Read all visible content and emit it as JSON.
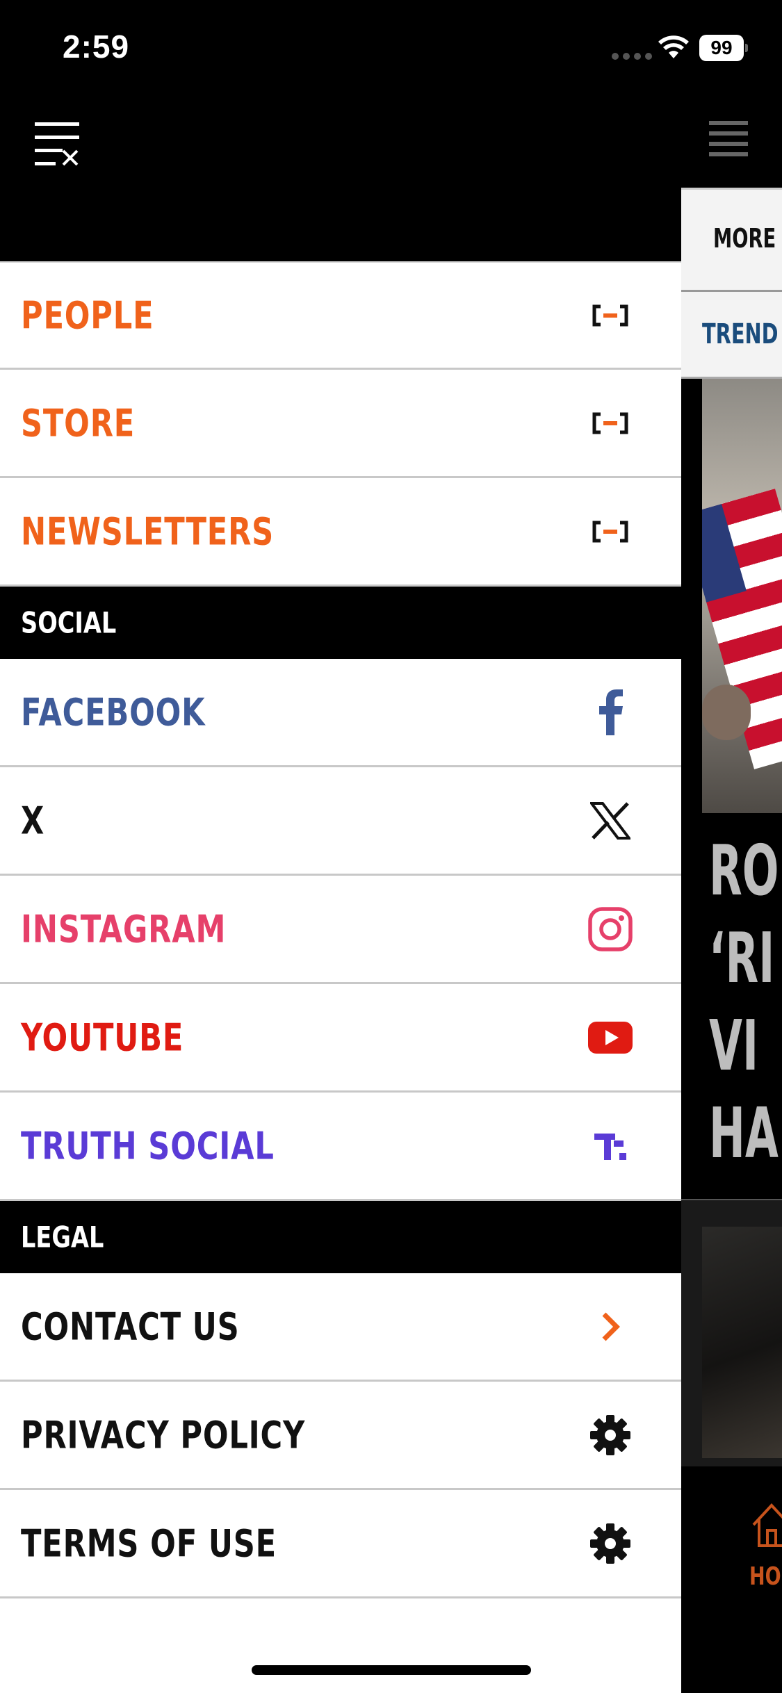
{
  "status_bar": {
    "time": "2:59",
    "battery": "99"
  },
  "background_app": {
    "more_label": "MORE",
    "trending_label": "TREND",
    "headline_lines": [
      "RO",
      "‘RI",
      "VI",
      "HA"
    ],
    "home_label": "HO"
  },
  "drawer": {
    "links": [
      {
        "label": "PEOPLE",
        "color": "#F0621B",
        "icon": "external-link-icon"
      },
      {
        "label": "STORE",
        "color": "#F0621B",
        "icon": "external-link-icon"
      },
      {
        "label": "NEWSLETTERS",
        "color": "#F0621B",
        "icon": "external-link-icon"
      }
    ],
    "social": {
      "title": "SOCIAL",
      "items": [
        {
          "label": "FACEBOOK",
          "color": "#3F5B99",
          "icon": "facebook-icon"
        },
        {
          "label": "X",
          "color": "#111111",
          "icon": "x-icon"
        },
        {
          "label": "INSTAGRAM",
          "color": "#E6406A",
          "icon": "instagram-icon"
        },
        {
          "label": "YOUTUBE",
          "color": "#E01B12",
          "icon": "youtube-icon"
        },
        {
          "label": "TRUTH SOCIAL",
          "color": "#5A3BD6",
          "icon": "truth-social-icon"
        }
      ]
    },
    "legal": {
      "title": "LEGAL",
      "items": [
        {
          "label": "CONTACT US",
          "color": "#111111",
          "icon": "chevron-right-icon"
        },
        {
          "label": "PRIVACY POLICY",
          "color": "#111111",
          "icon": "gear-icon"
        },
        {
          "label": "TERMS OF USE",
          "color": "#111111",
          "icon": "gear-icon"
        }
      ]
    }
  }
}
